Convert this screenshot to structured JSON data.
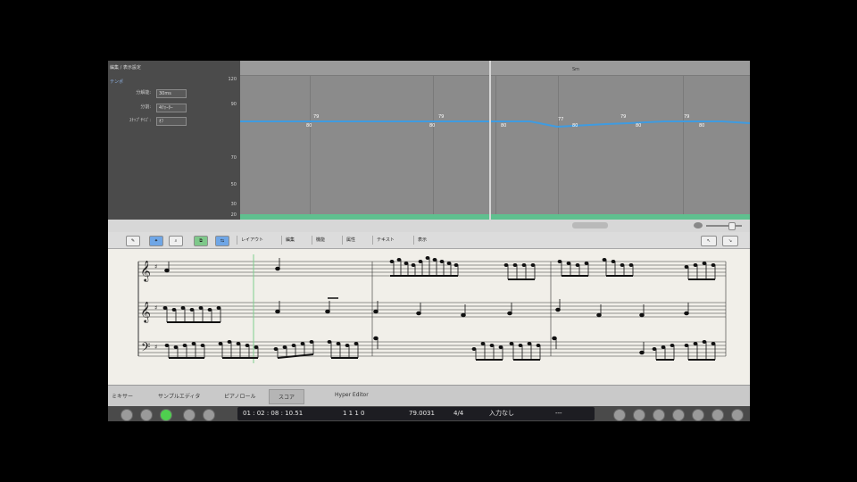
{
  "tempo": {
    "header": "編集 / 表示設定",
    "section": "テンポ",
    "rows": [
      {
        "label": "分解能:",
        "value": "30ms"
      },
      {
        "label": "分割:",
        "value": "4ｸｫｰﾀｰ"
      },
      {
        "label": "ｽﾅｯﾌﾟｻｲｽﾞ:",
        "value": "ｵﾌ"
      }
    ],
    "axis": [
      "120",
      "90",
      "70",
      "50",
      "30",
      "20"
    ],
    "ruler_label": "Sm",
    "point_labels": [
      "79",
      "80",
      "79",
      "80",
      "80",
      "77",
      "80",
      "79",
      "80",
      "79",
      "80"
    ],
    "line_color": "#3f9be0"
  },
  "toolbar": {
    "menus": [
      "レイアウト",
      "編集",
      "機能",
      "属性",
      "テキスト",
      "表示"
    ]
  },
  "score": {
    "time_signature_top": "4",
    "time_signature_bottom": "4",
    "staves": [
      "treble",
      "treble",
      "bass"
    ]
  },
  "tabs": {
    "items": [
      "ミキサー",
      "サンプルエディタ",
      "ピアノロール",
      "スコア",
      "Hyper Editor"
    ],
    "active": "スコア"
  },
  "transport": {
    "time": "01 : 02 : 08 : 10.51",
    "position": "1    1    1    0",
    "tempo": "79.0031",
    "signature": "4/4",
    "input": "入力なし",
    "extra": "---"
  }
}
